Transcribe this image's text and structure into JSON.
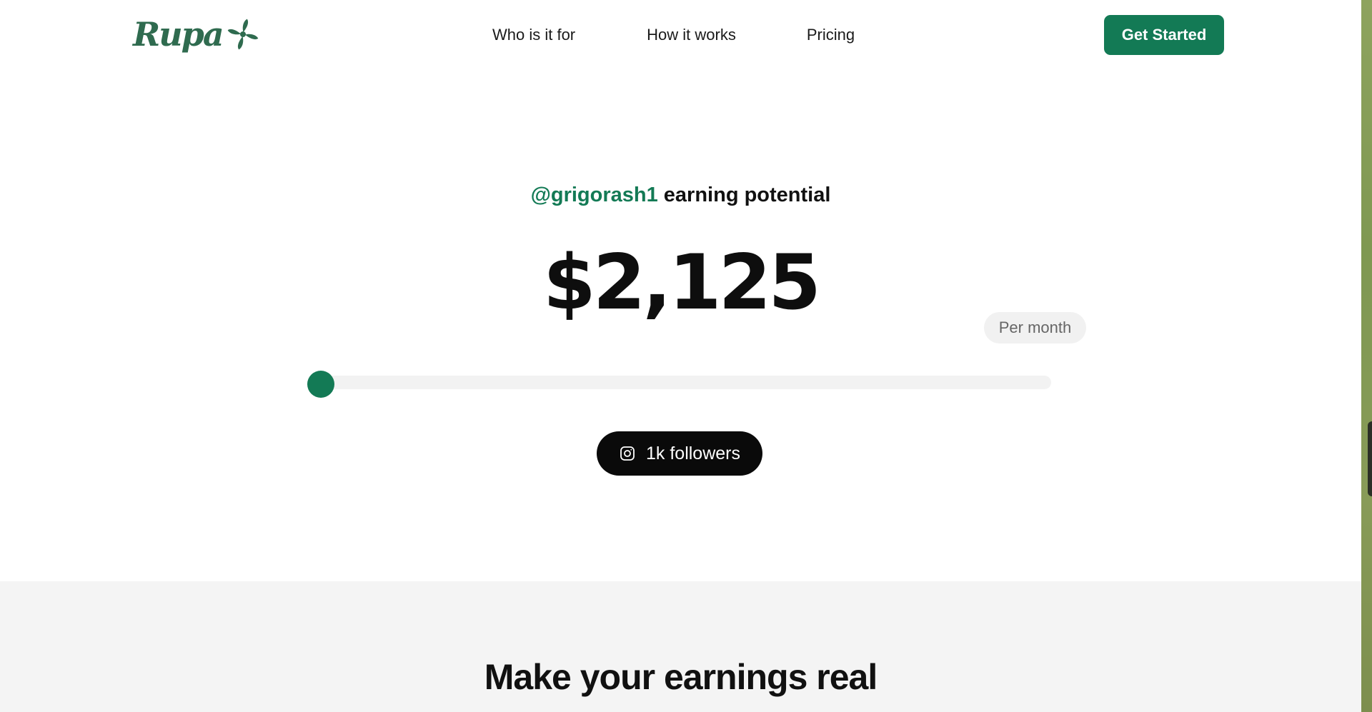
{
  "header": {
    "logo_text": "Rupa",
    "nav": [
      "Who is it for",
      "How it works",
      "Pricing"
    ],
    "cta_label": "Get Started"
  },
  "hero": {
    "handle": "@grigorash1",
    "headline_suffix": " earning potential",
    "amount": "$2,125",
    "period_label": "Per month",
    "slider_value": 0,
    "followers_label": "1k followers",
    "platform_icon": "instagram-icon"
  },
  "section2": {
    "title": "Make your earnings real"
  },
  "colors": {
    "brand_green": "#137a55",
    "logo_green": "#2f6b4f",
    "pill_bg": "#0a0a0a",
    "section_bg": "#f4f4f4"
  }
}
